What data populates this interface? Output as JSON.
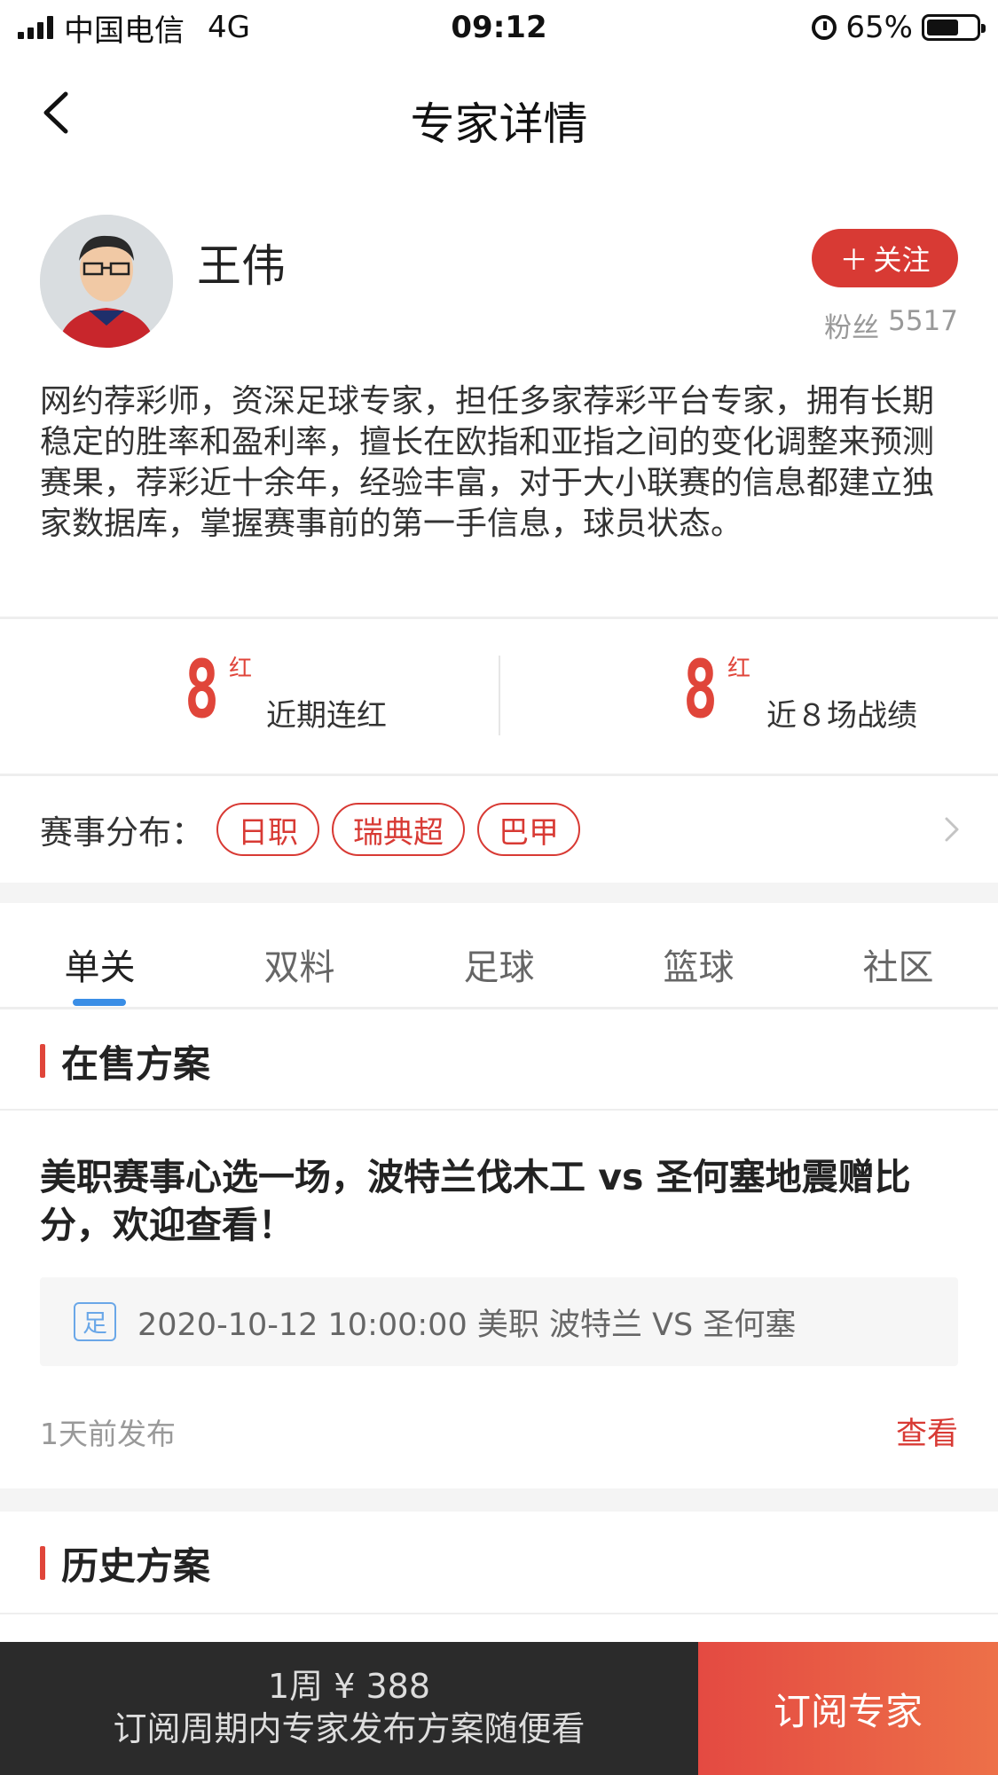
{
  "status_bar": {
    "carrier": "中国电信",
    "network": "4G",
    "time": "09:12",
    "battery": "65%",
    "battery_level": 0.65
  },
  "nav": {
    "title": "专家详情"
  },
  "profile": {
    "name": "王伟",
    "follow_label": "关注",
    "fans_label": "粉丝",
    "fans_count": "5517",
    "bio": "网约荐彩师，资深足球专家，担任多家荐彩平台专家，拥有长期稳定的胜率和盈利率，擅长在欧指和亚指之间的变化调整来预测赛果，荐彩近十余年，经验丰富，对于大小联赛的信息都建立独家数据库，掌握赛事前的第一手信息，球员状态。"
  },
  "stats": [
    {
      "value": "8",
      "unit": "红",
      "label": "近期连红"
    },
    {
      "value": "8",
      "unit": "红",
      "label": "近８场战绩"
    }
  ],
  "leagues": {
    "label": "赛事分布：",
    "tags": [
      "日职",
      "瑞典超",
      "巴甲"
    ]
  },
  "tabs": [
    "单关",
    "双料",
    "足球",
    "篮球",
    "社区"
  ],
  "on_sale": {
    "section_title": "在售方案",
    "plan_title": "美职赛事心选一场，波特兰伐木工 vs 圣何塞地震赠比分，欢迎查看！",
    "sport_badge": "足",
    "match_info": "2020-10-12 10:00:00 美职 波特兰 VS 圣何塞",
    "published": "1天前发布",
    "view_label": "查看"
  },
  "history": {
    "section_title": "历史方案"
  },
  "bottom_bar": {
    "price": "1周 ¥ 388",
    "price_desc": "订阅周期内专家发布方案随便看",
    "subscribe_label": "订阅专家"
  }
}
